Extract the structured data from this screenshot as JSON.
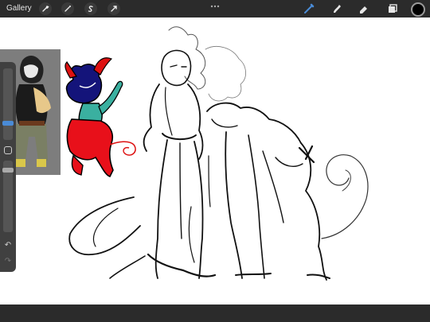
{
  "topbar": {
    "gallery_label": "Gallery",
    "left_tools": [
      {
        "name": "actions-wrench-icon"
      },
      {
        "name": "adjustments-wand-icon"
      },
      {
        "name": "selection-s-icon"
      },
      {
        "name": "transform-arrow-icon"
      }
    ],
    "right_tools": [
      {
        "name": "brush-icon",
        "active": true
      },
      {
        "name": "smudge-icon"
      },
      {
        "name": "eraser-icon"
      },
      {
        "name": "layers-icon"
      }
    ],
    "current_color": "#000000"
  },
  "sidebar": {
    "undo_icon": "undo-arrow-icon",
    "redo_icon": "redo-arrow-icon",
    "modify_icon": "modify-square-icon"
  },
  "colors": {
    "accent": "#4a8bd6",
    "bar": "#2b2b2b"
  }
}
